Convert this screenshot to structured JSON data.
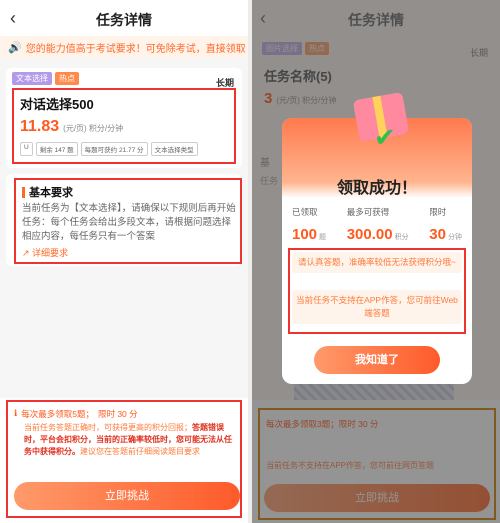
{
  "left": {
    "nav": {
      "back_icon": "chevron-left-icon",
      "title": "任务详情"
    },
    "notice": {
      "icon": "speaker-icon",
      "text": "您的能力值高于考试要求！可免除考试，直接领取"
    },
    "task": {
      "tags": [
        "文本选择",
        "热点"
      ],
      "duration": "长期",
      "name": "对话选择500",
      "price": "11.83",
      "price_meta": "(元/页) 积分/分钟",
      "chips": [
        "U",
        "剩余 147 题",
        "每题可获约 21.77 分",
        "文本选择类型"
      ]
    },
    "requirements": {
      "title": "基本要求",
      "text": "当前任务为【文本选择】，请确保以下规则后再开始任务：每个任务会给出多段文本，请根据问题选择相应内容，每任务只有一个答案",
      "link": "详细要求"
    },
    "bottom": {
      "head_left": "每次最多领取5题；",
      "head_right": "限时 30 分",
      "text_1": "当前任务答题正确时，可获得更高的积分回报；",
      "text_bold": "答题错误时，平台会扣积分，当前的正确率较低时，您可能无法从任务中获得积分。",
      "text_2": "建议您在答题前仔细阅读题目要求",
      "button": "立即挑战"
    }
  },
  "right": {
    "nav": {
      "back_icon": "chevron-left-icon",
      "title": "任务详情"
    },
    "bg": {
      "tags": [
        "图片选择",
        "热点"
      ],
      "duration": "长期",
      "name": "任务名称(5)",
      "price": "3",
      "price_meta": "(元/页) 积分/分钟",
      "side_title": "基",
      "side_sub": "任务",
      "bottom_head": "每次最多领取3题；限时 30 分",
      "bottom_text": "当前任务不支持在APP作答，您可前往网页答题",
      "bottom_button": "立即挑战"
    },
    "modal": {
      "title": "领取成功！",
      "stats": [
        {
          "label": "已领取",
          "value": "100",
          "unit": "题"
        },
        {
          "label": "最多可获得",
          "value": "300.00",
          "unit": "积分"
        },
        {
          "label": "限时",
          "value": "30",
          "unit": "分钟"
        }
      ],
      "note_1": "请认真答题，准确率较低无法获得积分哦~",
      "note_2": "当前任务不支持在APP作答，您可前往Web端答题",
      "button": "我知道了"
    }
  },
  "colors": {
    "accent": "#ff5a1e",
    "highlight_box": "#e33333",
    "success": "#2fbf4a"
  }
}
